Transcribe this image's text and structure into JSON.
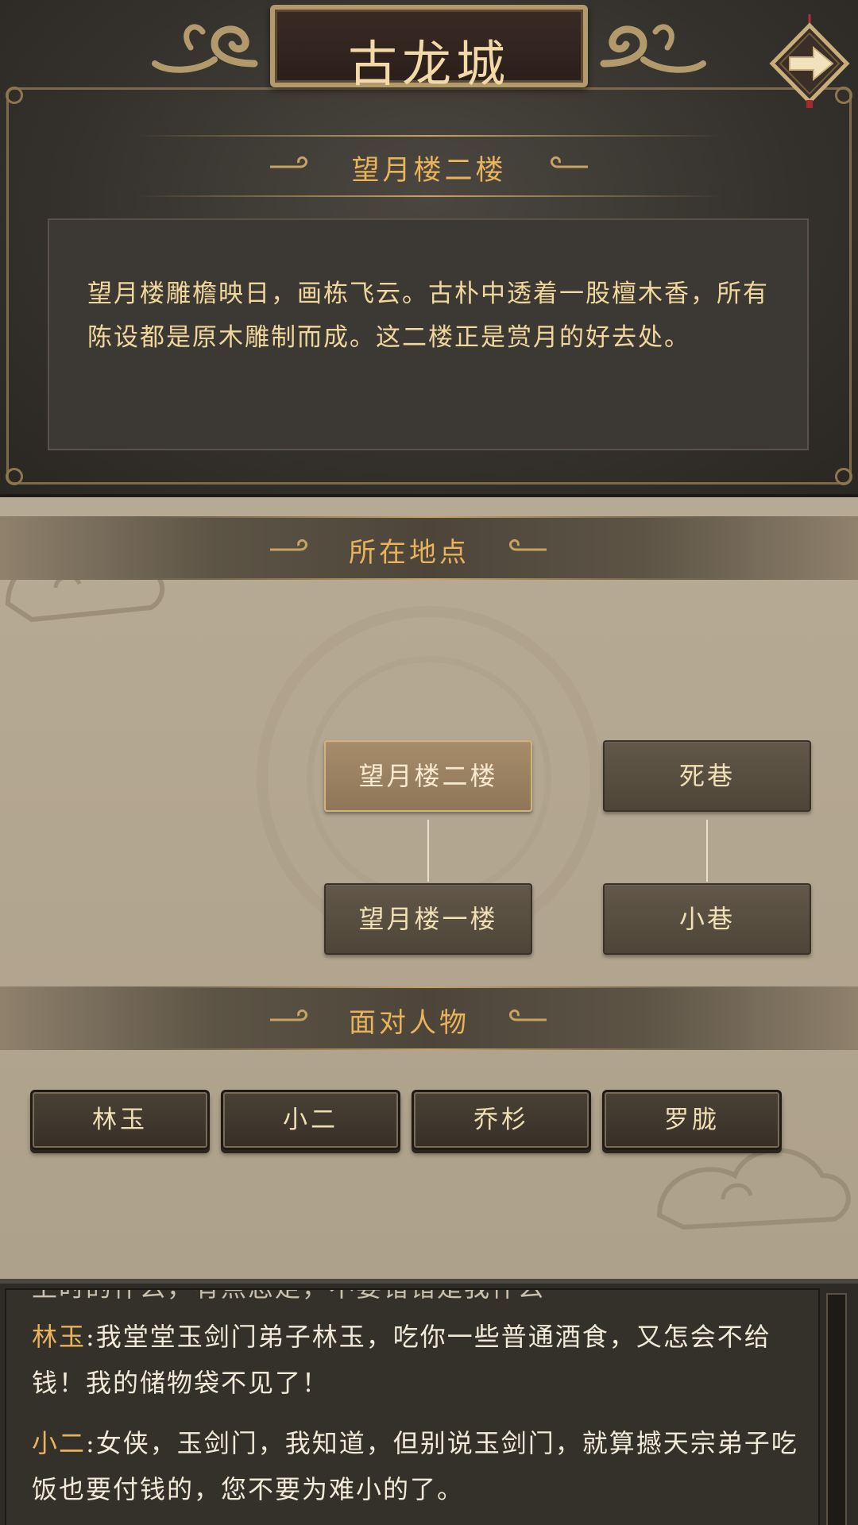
{
  "header": {
    "city_title": "古龙城",
    "next_icon": "arrow-right-icon"
  },
  "scene": {
    "title": "望月楼二楼",
    "description": "望月楼雕檐映日，画栋飞云。古朴中透着一股檀木香，所有陈设都是原木雕制而成。这二楼正是赏月的好去处。"
  },
  "location_section": {
    "title": "所在地点",
    "nodes": [
      {
        "label": "望月楼二楼",
        "current": true
      },
      {
        "label": "死巷",
        "current": false
      },
      {
        "label": "望月楼一楼",
        "current": false
      },
      {
        "label": "小巷",
        "current": false
      }
    ]
  },
  "characters_section": {
    "title": "面对人物",
    "characters": [
      "林玉",
      "小二",
      "乔杉",
      "罗胧"
    ]
  },
  "dialogue_log": [
    {
      "speaker": "",
      "text": "上时的什么，有点恋走，不要错错是我什么"
    },
    {
      "speaker": "林玉",
      "text": ":我堂堂玉剑门弟子林玉，吃你一些普通酒食，又怎会不给钱！我的储物袋不见了！"
    },
    {
      "speaker": "小二",
      "text": ":女侠，玉剑门，我知道，但别说玉剑门，就算撼天宗弟子吃饭也要付钱的，您不要为难小的了。"
    }
  ],
  "colors": {
    "accent_gold": "#e8b35a",
    "text_cream": "#f0d79c",
    "current_node": "#a68c6a",
    "panel_dark": "#34312c"
  }
}
